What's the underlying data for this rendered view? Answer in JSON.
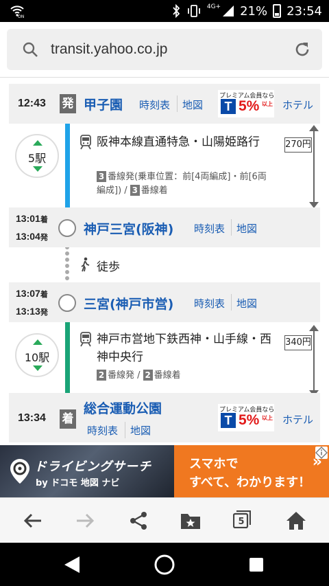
{
  "status_bar": {
    "network": "4G+",
    "battery": "21%",
    "time": "23:54"
  },
  "url_bar": {
    "url": "transit.yahoo.co.jp"
  },
  "route": {
    "departure": {
      "time": "12:43",
      "badge": "発",
      "station": "甲子園",
      "timetable_link": "時刻表",
      "map_link": "地図",
      "hotel_link": "ホテル"
    },
    "leg1": {
      "stops": "5駅",
      "train": "阪神本線直通特急・山陽姫路行",
      "platform_info_a": "3",
      "platform_info_b": "番線発(乗車位置：前[4両編成]・前[6両編成]) /",
      "platform_info_c": "3",
      "platform_info_d": "番線着",
      "fare": "270円",
      "line_color": "#1fa3e8"
    },
    "transfer1": {
      "arr_time": "13:01",
      "arr_suffix": "着",
      "dep_time": "13:04",
      "dep_suffix": "発",
      "station": "神戸三宮(阪神)",
      "timetable_link": "時刻表",
      "map_link": "地図"
    },
    "walk": {
      "label": "徒歩"
    },
    "transfer2": {
      "arr_time": "13:07",
      "arr_suffix": "着",
      "dep_time": "13:13",
      "dep_suffix": "発",
      "station": "三宮(神戸市営)",
      "timetable_link": "時刻表",
      "map_link": "地図"
    },
    "leg2": {
      "stops": "10駅",
      "train": "神戸市営地下鉄西神・山手線・西神中央行",
      "platform_a": "2",
      "platform_b": "番線発 /",
      "platform_c": "2",
      "platform_d": "番線着",
      "fare": "340円",
      "line_color": "#1aa477"
    },
    "arrival": {
      "time": "13:34",
      "badge": "着",
      "station": "総合運動公園",
      "timetable_link": "時刻表",
      "map_link": "地図",
      "hotel_link": "ホテル"
    }
  },
  "tpoint_ad": {
    "top_text": "プレミアム会員なら",
    "logo": "T",
    "percent": "5%",
    "up_to": "以上"
  },
  "banner_ad": {
    "title": "ドライビングサーチ",
    "subtitle": "by ドコモ 地図 ナビ",
    "right_line1": "スマホで",
    "right_line2": "すべて、わかります！",
    "chevron": "»"
  },
  "toolbar": {
    "tab_count": "5"
  },
  "icons": [
    "wifi-icon",
    "bluetooth-icon",
    "vibrate-icon",
    "signal-icon",
    "battery-icon",
    "search-icon",
    "reload-icon",
    "train-icon",
    "walk-icon",
    "back-icon",
    "forward-icon",
    "share-icon",
    "bookmark-icon",
    "tabs-icon",
    "home-icon"
  ]
}
